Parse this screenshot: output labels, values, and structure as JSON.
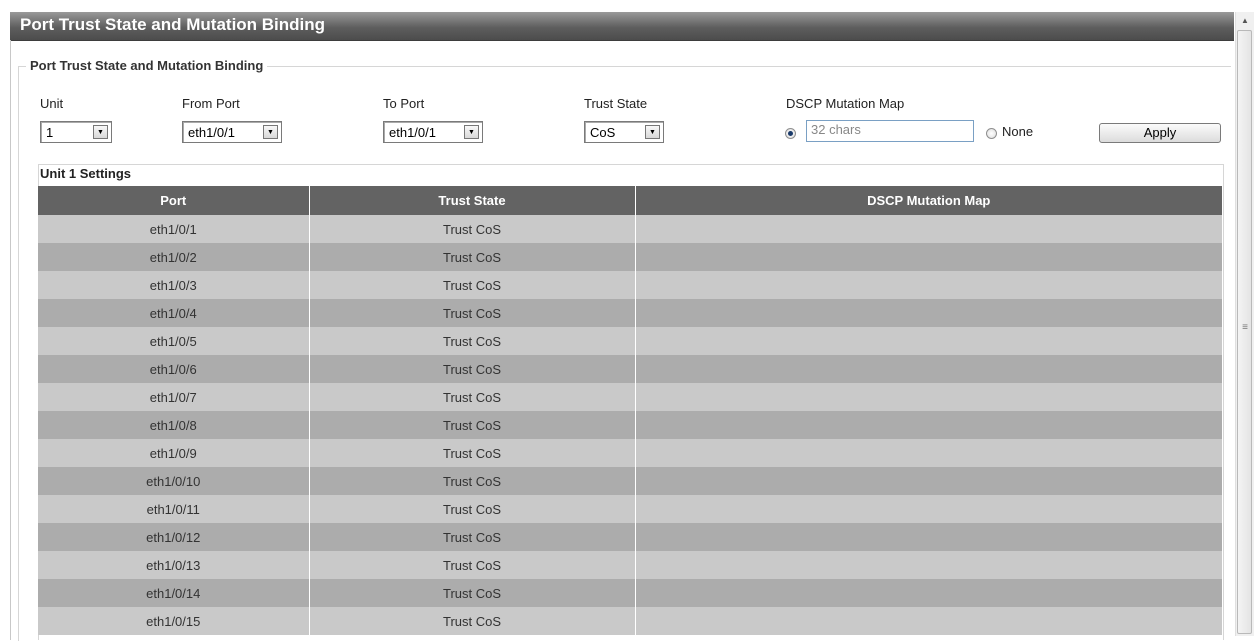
{
  "page": {
    "title": "Port Trust State and Mutation Binding"
  },
  "form": {
    "legend": "Port Trust State and Mutation Binding",
    "unit_label": "Unit",
    "unit_value": "1",
    "from_port_label": "From Port",
    "from_port_value": "eth1/0/1",
    "to_port_label": "To Port",
    "to_port_value": "eth1/0/1",
    "trust_state_label": "Trust State",
    "trust_state_value": "CoS",
    "dscp_label": "DSCP Mutation Map",
    "dscp_placeholder": "32 chars",
    "none_label": "None",
    "apply_label": "Apply"
  },
  "settings": {
    "title": "Unit 1 Settings",
    "columns": [
      "Port",
      "Trust State",
      "DSCP Mutation Map"
    ],
    "rows": [
      {
        "port": "eth1/0/1",
        "trust_state": "Trust CoS",
        "dscp_map": ""
      },
      {
        "port": "eth1/0/2",
        "trust_state": "Trust CoS",
        "dscp_map": ""
      },
      {
        "port": "eth1/0/3",
        "trust_state": "Trust CoS",
        "dscp_map": ""
      },
      {
        "port": "eth1/0/4",
        "trust_state": "Trust CoS",
        "dscp_map": ""
      },
      {
        "port": "eth1/0/5",
        "trust_state": "Trust CoS",
        "dscp_map": ""
      },
      {
        "port": "eth1/0/6",
        "trust_state": "Trust CoS",
        "dscp_map": ""
      },
      {
        "port": "eth1/0/7",
        "trust_state": "Trust CoS",
        "dscp_map": ""
      },
      {
        "port": "eth1/0/8",
        "trust_state": "Trust CoS",
        "dscp_map": ""
      },
      {
        "port": "eth1/0/9",
        "trust_state": "Trust CoS",
        "dscp_map": ""
      },
      {
        "port": "eth1/0/10",
        "trust_state": "Trust CoS",
        "dscp_map": ""
      },
      {
        "port": "eth1/0/11",
        "trust_state": "Trust CoS",
        "dscp_map": ""
      },
      {
        "port": "eth1/0/12",
        "trust_state": "Trust CoS",
        "dscp_map": ""
      },
      {
        "port": "eth1/0/13",
        "trust_state": "Trust CoS",
        "dscp_map": ""
      },
      {
        "port": "eth1/0/14",
        "trust_state": "Trust CoS",
        "dscp_map": ""
      },
      {
        "port": "eth1/0/15",
        "trust_state": "Trust CoS",
        "dscp_map": ""
      }
    ]
  },
  "icons": {
    "dropdown": "chevron-down-icon",
    "scroll_up": "arrow-up-icon",
    "scroll_grip": "grip-icon"
  },
  "colors": {
    "title_bar": "#5e5e5e",
    "header_row": "#636363",
    "row_light": "#c9c9c9",
    "row_dark": "#acacac"
  }
}
